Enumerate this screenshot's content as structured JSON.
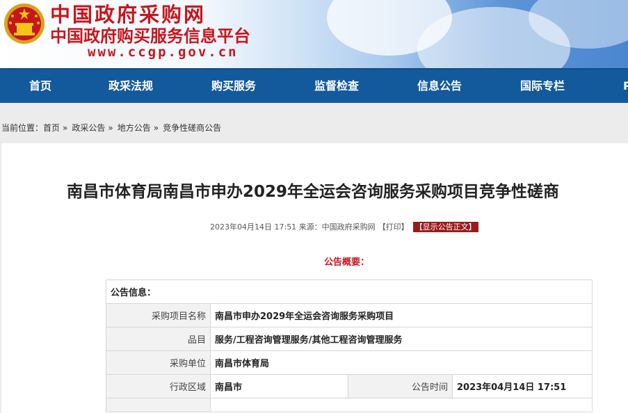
{
  "header": {
    "site_title": "中国政府采购网",
    "site_subtitle": "中国政府购买服务信息平台",
    "site_url": "www.ccgp.gov.cn",
    "emblem_icon": "national-emblem-icon",
    "brand_red": "#c8161d",
    "nav_blue": "#135a9c"
  },
  "nav": {
    "items": [
      "首页",
      "政采法规",
      "购买服务",
      "监督检查",
      "信息公告",
      "国际专栏",
      "P"
    ]
  },
  "breadcrumb": {
    "prefix": "当前位置：",
    "items": [
      "首页",
      "政采公告",
      "地方公告",
      "竞争性磋商公告"
    ],
    "separator": "»"
  },
  "article": {
    "title": "南昌市体育局南昌市申办2029年全运会咨询服务采购项目竞争性磋商",
    "datetime_source": "2023年04月14日 17:51 来源：中国政府采购网",
    "print_label": "【打印】",
    "show_text_label": "【显示公告正文】",
    "summary_label": "公告概要："
  },
  "info_table": {
    "header": "公告信息：",
    "rows": [
      {
        "label": "采购项目名称",
        "value": "南昌市申办2029年全运会咨询服务采购项目"
      },
      {
        "label": "品目",
        "value": "服务/工程咨询管理服务/其他工程咨询管理服务"
      },
      {
        "label": "采购单位",
        "value": "南昌市体育局"
      }
    ],
    "split_row": {
      "label1": "行政区域",
      "value1": "南昌市",
      "label2": "公告时间",
      "value2": "2023年04月14日  17:51"
    }
  }
}
